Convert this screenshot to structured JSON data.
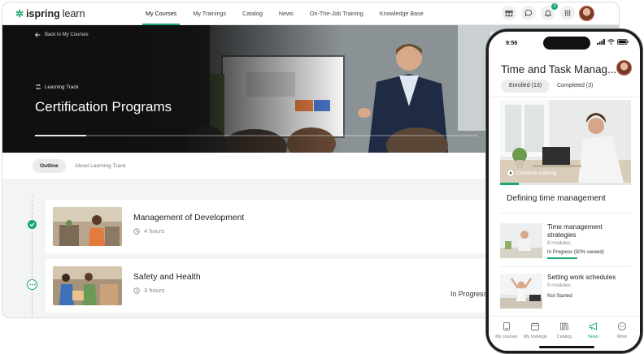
{
  "brand": {
    "name_bold": "ispring",
    "name_light": "learn",
    "accent": "#18a86b"
  },
  "topnav": {
    "links": [
      "My Courses",
      "My Trainings",
      "Catalog",
      "News",
      "On-The-Job Training",
      "Knowledge Base"
    ],
    "active_index": 0,
    "notification_count": "3"
  },
  "hero": {
    "back_label": "Back to My Courses",
    "type_label": "Learning Track",
    "title": "Certification Programs",
    "progress": 0.115
  },
  "tabs": {
    "outline": "Outline",
    "about": "About Learning Track"
  },
  "courses": [
    {
      "title": "Management of Development",
      "duration": "4 hours",
      "status": ""
    },
    {
      "title": "Safety and Health",
      "duration": "3 hours",
      "status": "In Progress"
    }
  ],
  "phone": {
    "time": "9:56",
    "title": "Time and Task Manag...",
    "tabs": {
      "enrolled": "Enrolled (13)",
      "completed": "Completed (3)"
    },
    "continue_label": "Continue training",
    "progress": 0.14,
    "heading": "Defining time management",
    "modules": [
      {
        "title": "Time management strategies",
        "count": "8 modules",
        "status": "In Progress (50% viewed)",
        "progress": 0.5
      },
      {
        "title": "Setting work schedules",
        "count": "5 modules",
        "status": "Not Started",
        "progress": 0
      }
    ],
    "bottom_nav": [
      "My courses",
      "My trainings",
      "Catalog",
      "News",
      "More"
    ],
    "bottom_active_index": 3
  }
}
